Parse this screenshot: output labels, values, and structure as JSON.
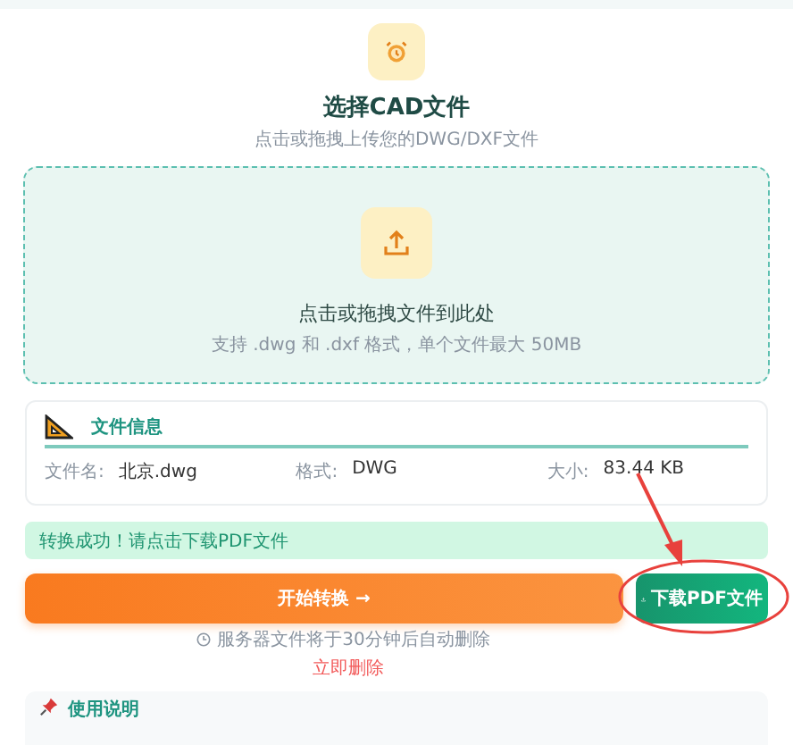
{
  "header": {
    "title": "选择CAD文件",
    "subtitle": "点击或拖拽上传您的DWG/DXF文件"
  },
  "dropzone": {
    "title": "点击或拖拽文件到此处",
    "hint": "支持 .dwg 和 .dxf 格式，单个文件最大 50MB"
  },
  "file_info": {
    "title": "文件信息",
    "fields": [
      {
        "label": "文件名:",
        "value": "北京.dwg"
      },
      {
        "label": "格式:",
        "value": "DWG"
      },
      {
        "label": "大小:",
        "value": "83.44 KB"
      }
    ]
  },
  "status": {
    "text": "转换成功！请点击下载PDF文件"
  },
  "actions": {
    "convert": {
      "label": "开始转换",
      "arrow": "→"
    },
    "download": {
      "label": "下载PDF文件"
    }
  },
  "note": "服务器文件将于30分钟后自动删除",
  "delete_link": "立即删除",
  "usage": {
    "title": "使用说明"
  }
}
